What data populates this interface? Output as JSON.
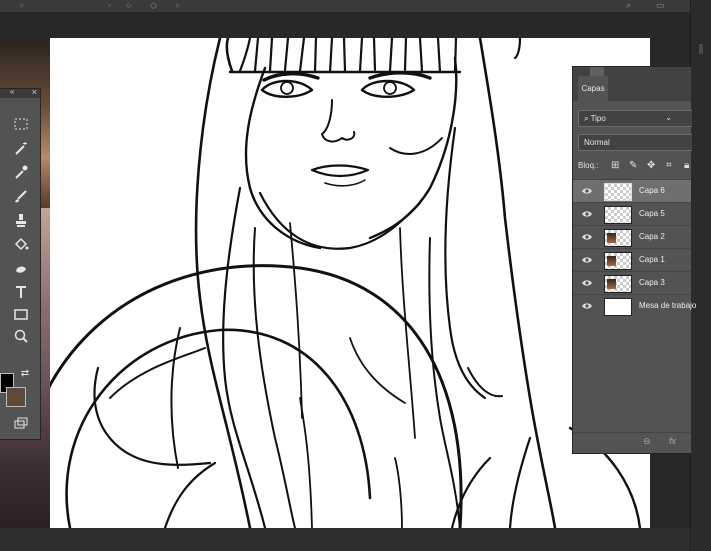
{
  "layers_panel": {
    "tab": "Capas",
    "filter_kind": "Tipo",
    "blend_mode": "Normal",
    "lock_label": "Bloq.:",
    "footer": {
      "link_icon": "link-icon",
      "fx_label": "fx"
    },
    "layers": [
      {
        "name": "Capa 6",
        "thumb": "transparent",
        "selected": true
      },
      {
        "name": "Capa 5",
        "thumb": "transparent",
        "selected": false
      },
      {
        "name": "Capa 2",
        "thumb": "photo",
        "selected": false
      },
      {
        "name": "Capa 1",
        "thumb": "photo",
        "selected": false
      },
      {
        "name": "Capa 3",
        "thumb": "photo",
        "selected": false
      },
      {
        "name": "Mesa de trabajo",
        "thumb": "white",
        "selected": false
      }
    ]
  },
  "tools": [
    "marquee-icon",
    "magic-wand-icon",
    "eyedropper-icon",
    "brush-icon",
    "clone-stamp-icon",
    "paint-bucket-icon",
    "smudge-icon",
    "type-icon",
    "rectangle-icon",
    "zoom-icon"
  ],
  "colors": {
    "ui_bg": "#282828",
    "panel": "#535353",
    "panel_dark": "#424242",
    "selected_row": "#6f6f6f",
    "foreground_swatch": "#000000",
    "background_swatch": "#5e4a3c",
    "canvas": "#ffffff"
  }
}
